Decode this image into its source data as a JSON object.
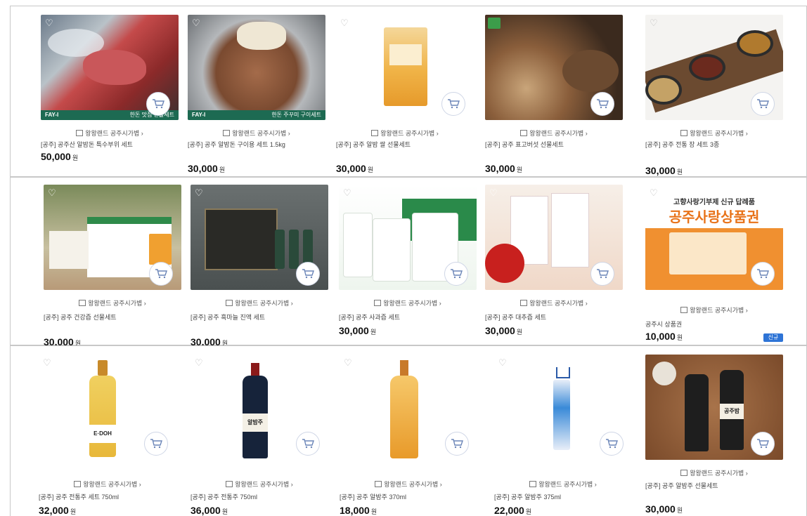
{
  "currency_suffix": "원",
  "store_label": "왕왕랜드 공주시가볍",
  "rows": [
    {
      "products": [
        {
          "name": "[공주] 공주산 알밤돈 특수부위 세트",
          "price": "50,000",
          "label_left": "FAY-I",
          "label_right": "한돈 맛집 선물세트",
          "heart": "white"
        },
        {
          "name": "[공주] 공주 알밤돈 구이용 세트 1.5kg",
          "price": "30,000",
          "label_left": "FAY-I",
          "label_right": "한돈 주꾸미 구이세트",
          "heart": "white"
        },
        {
          "name": "[공주] 공주 알밤 쌀 선물세트",
          "price": "30,000",
          "heart": "gray"
        },
        {
          "name": "[공주] 공주 표고버섯 선물세트",
          "price": "30,000",
          "heart": "gray"
        },
        {
          "name": "[공주] 공주 전통 장 세트 3종",
          "price": "30,000",
          "heart": "gray"
        }
      ]
    },
    {
      "products": [
        {
          "name": "[공주] 공주 건강즙 선물세트",
          "price": "30,000",
          "heart": "white"
        },
        {
          "name": "[공주] 공주 흑마늘 진액 세트",
          "price": "30,000",
          "heart": "white"
        },
        {
          "name": "[공주] 공주 사과즙 세트",
          "price": "30,000",
          "heart": "gray"
        },
        {
          "name": "[공주] 공주 대추즙 세트",
          "price": "30,000",
          "heart": "white"
        },
        {
          "name": "공주시 상품권",
          "price": "10,000",
          "heart": "gray",
          "banner_top": "고향사랑기부제 신규 답례품",
          "banner_title": "공주사랑상품권",
          "badge": "신규"
        }
      ]
    },
    {
      "products": [
        {
          "name": "[공주] 공주 전통주 세트 750ml",
          "price": "32,000",
          "bottle_label": "E·DOH",
          "heart": "gray"
        },
        {
          "name": "[공주] 공주 전통주 750ml",
          "price": "36,000",
          "bottle_label": "알밤주",
          "heart": "gray"
        },
        {
          "name": "[공주] 공주 알밤주 370ml",
          "price": "18,000",
          "heart": "gray"
        },
        {
          "name": "[공주] 공주 알밤주 375ml",
          "price": "22,000",
          "heart": "gray"
        },
        {
          "name": "[공주] 공주 알밤주 선물세트",
          "price": "30,000",
          "bottle_label": "공주밤",
          "heart": "gray"
        }
      ]
    }
  ]
}
